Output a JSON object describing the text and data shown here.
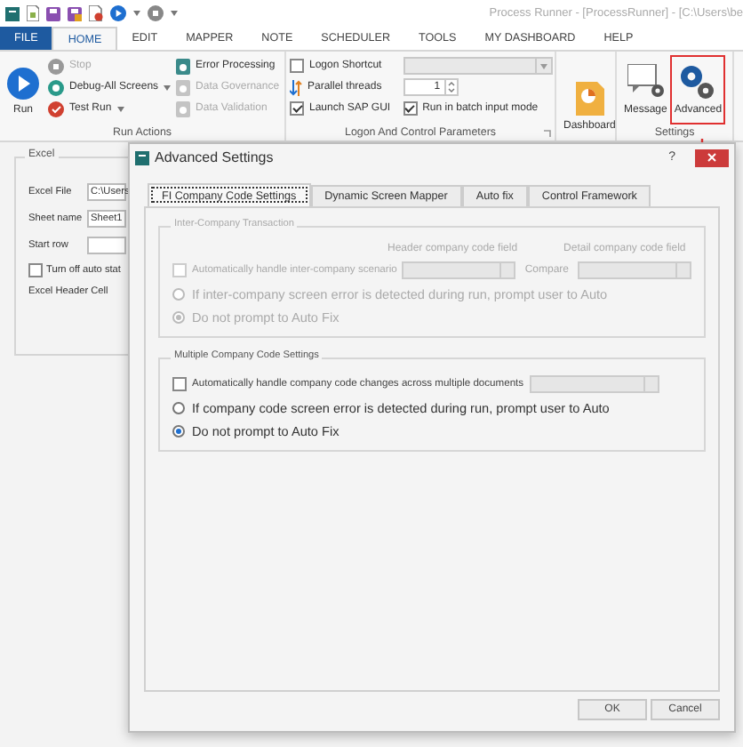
{
  "app": {
    "title": "Process Runner - [ProcessRunner] - [C:\\Users\\be"
  },
  "ribbon_tabs": [
    {
      "label": "FILE",
      "kind": "file",
      "selected": false
    },
    {
      "label": "HOME",
      "kind": "tab",
      "selected": true
    },
    {
      "label": "EDIT",
      "kind": "tab",
      "selected": false
    },
    {
      "label": "MAPPER",
      "kind": "tab",
      "selected": false
    },
    {
      "label": "NOTE",
      "kind": "tab",
      "selected": false
    },
    {
      "label": "SCHEDULER",
      "kind": "tab",
      "selected": false
    },
    {
      "label": "TOOLS",
      "kind": "tab",
      "selected": false
    },
    {
      "label": "MY DASHBOARD",
      "kind": "tab",
      "selected": false
    },
    {
      "label": "HELP",
      "kind": "tab",
      "selected": false
    }
  ],
  "run_actions": {
    "label": "Run Actions",
    "run": {
      "label": "Run"
    },
    "column_1": [
      {
        "label": "Stop",
        "kind": "stop",
        "disabled": true,
        "dropdown": false
      },
      {
        "label": "Debug-All Screens",
        "kind": "debug",
        "disabled": false,
        "dropdown": true
      },
      {
        "label": "Test Run",
        "kind": "test",
        "disabled": false,
        "dropdown": true
      }
    ],
    "column_2": [
      {
        "label": "Error Processing",
        "disabled": false
      },
      {
        "label": "Data Governance",
        "disabled": true
      },
      {
        "label": "Data Validation",
        "disabled": true
      }
    ]
  },
  "logon": {
    "label": "Logon And Control Parameters",
    "logon_shortcut": {
      "label": "Logon Shortcut",
      "checked": false
    },
    "parallel_threads": {
      "label": "Parallel threads",
      "value": "1"
    },
    "launch_sap_gui": {
      "label": "Launch SAP GUI",
      "checked": true
    },
    "batch_input": {
      "label": "Run in batch input mode",
      "checked": true
    }
  },
  "dashboard": {
    "label": "Dashboard"
  },
  "settings": {
    "label": "Settings",
    "buttons": [
      {
        "label": "Message",
        "kind": "message",
        "highlighted": false
      },
      {
        "label": "Advanced",
        "kind": "gears",
        "highlighted": true
      }
    ]
  },
  "excel": {
    "title": "Excel",
    "excel_file": {
      "label": "Excel File",
      "value": "C:\\Users"
    },
    "sheet_name": {
      "label": "Sheet name",
      "value": "Sheet1"
    },
    "start_row": {
      "label": "Start row"
    },
    "auto_status": {
      "label": "Turn off auto stat",
      "checked": false
    },
    "header_cell": {
      "label": "Excel Header Cell"
    }
  },
  "dialog": {
    "title": "Advanced Settings",
    "help": "?",
    "tabs": [
      {
        "label": "FI Company Code Settings",
        "selected": true
      },
      {
        "label": "Dynamic Screen Mapper",
        "selected": false
      },
      {
        "label": "Auto fix",
        "selected": false
      },
      {
        "label": "Control Framework",
        "selected": false
      }
    ],
    "sections": [
      {
        "kind": "inter",
        "title": "Inter-Company Transaction",
        "disabled": true,
        "checkbox": {
          "label": "Automatically handle inter-company scenario",
          "checked": false
        },
        "header_field": {
          "label": "Header company code field"
        },
        "compare_label": "Compare",
        "detail_field": {
          "label": "Detail company code field"
        },
        "radios": [
          {
            "label": "If inter-company screen error is detected during run, prompt user to Auto",
            "selected": false
          },
          {
            "label": "Do not prompt to Auto Fix",
            "selected": true
          }
        ]
      },
      {
        "kind": "multi",
        "title": "Multiple Company Code Settings",
        "disabled": false,
        "checkbox": {
          "label": "Automatically handle company code changes across multiple documents",
          "checked": false
        },
        "radios": [
          {
            "label": "If company code screen error is detected during run, prompt user to Auto",
            "selected": false
          },
          {
            "label": "Do not prompt to Auto Fix",
            "selected": true
          }
        ]
      }
    ],
    "buttons": [
      {
        "label": "OK"
      },
      {
        "label": "Cancel"
      }
    ]
  }
}
